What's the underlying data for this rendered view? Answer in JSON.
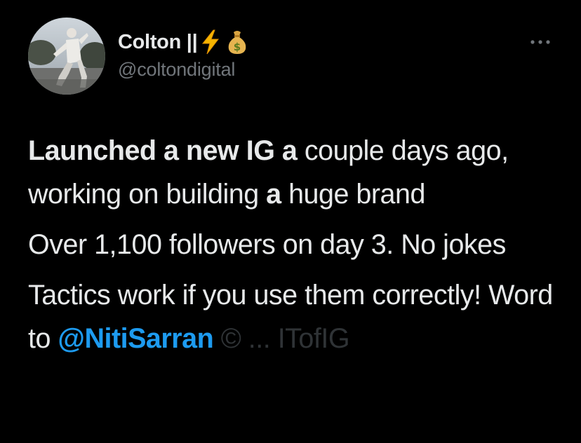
{
  "tweet": {
    "author": {
      "name": "Colton ||",
      "emojis": [
        "lightning-emoji",
        "money-bag-emoji"
      ],
      "handle": "@coltondigital"
    },
    "more_icon": "more-dots-icon",
    "body": {
      "p1": {
        "s1": "Launched a new IG a",
        "s2": " couple days ago, working on building ",
        "s3": "a",
        "s4": " huge brand"
      },
      "p2": "Over 1,100 followers on day 3. No jokes",
      "p3": {
        "s1": "Tactics work if you use them correctly! Word to ",
        "mention": "@NitiSarran",
        "faded": " © ",
        "faded2": "... ",
        "faded3": "ITofIG"
      }
    },
    "colors": {
      "background": "#000000",
      "text": "#e7e9ea",
      "secondary": "#71767b",
      "link": "#1d9bf0"
    }
  }
}
